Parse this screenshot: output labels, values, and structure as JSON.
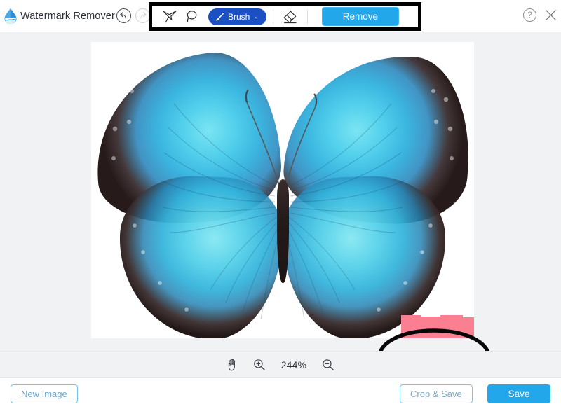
{
  "app": {
    "title": "Watermark Remover",
    "logo_icon": "water-drop-logo",
    "accent_blue": "#22a7ea",
    "brush_blue": "#1b4fc4",
    "selection_pink": "#fa7f90",
    "outline_blue": "#74c5ef"
  },
  "header": {
    "undo": {
      "label": "Undo",
      "icon": "undo-arrow-icon",
      "enabled": true
    },
    "redo": {
      "label": "Redo",
      "icon": "redo-arrow-icon",
      "enabled": false
    },
    "tools": [
      {
        "name": "polygonal-lasso",
        "label": "Polygonal Lasso",
        "icon": "polygonal-lasso-icon",
        "selected": false
      },
      {
        "name": "free-lasso",
        "label": "Lasso",
        "icon": "lasso-icon",
        "selected": false
      },
      {
        "name": "brush",
        "label": "Brush",
        "icon": "brush-icon",
        "selected": true,
        "chevron": "⌄"
      },
      {
        "name": "eraser",
        "label": "Eraser",
        "icon": "eraser-icon",
        "selected": false
      }
    ],
    "remove_label": "Remove",
    "help_label": "?",
    "close_label": "×"
  },
  "workspace": {
    "image_alt": "Blue morpho butterfly specimen on white background",
    "selection_note": "pink brush selection over watermark area",
    "annotation_note": "hand drawn black ellipse highlight"
  },
  "zoombar": {
    "pan_label": "Pan",
    "pan_icon": "hand-icon",
    "zoom_in_label": "Zoom In",
    "zoom_in_icon": "zoom-in-icon",
    "zoom_out_label": "Zoom Out",
    "zoom_out_icon": "zoom-out-icon",
    "zoom_value": "244%"
  },
  "footer": {
    "new_image_label": "New Image",
    "crop_save_label": "Crop & Save",
    "save_label": "Save"
  }
}
